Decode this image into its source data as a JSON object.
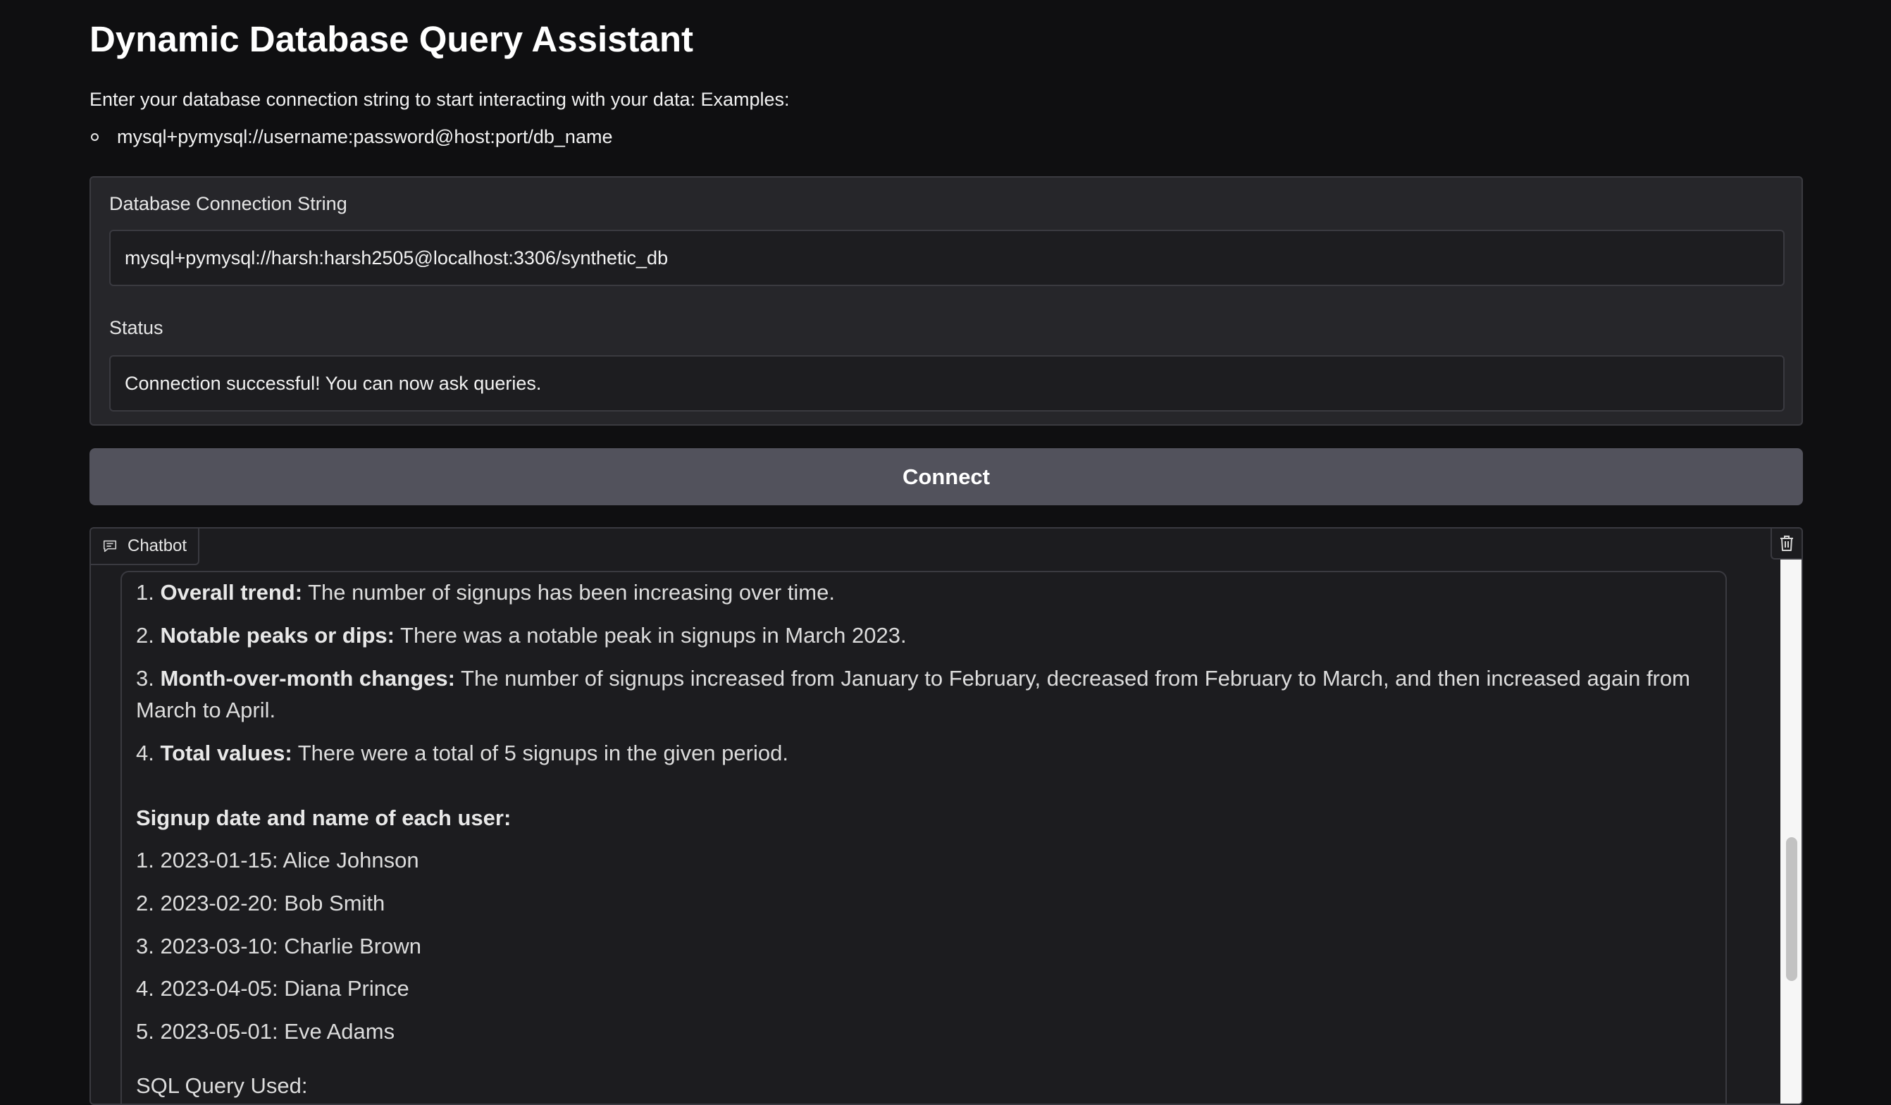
{
  "app": {
    "title": "Dynamic Database Query Assistant",
    "intro": "Enter your database connection string to start interacting with your data: Examples:",
    "examples": [
      "mysql+pymysql://username:password@host:port/db_name"
    ]
  },
  "connection": {
    "label": "Database Connection String",
    "value": "mysql+pymysql://harsh:harsh2505@localhost:3306/synthetic_db",
    "status_label": "Status",
    "status_value": "Connection successful! You can now ask queries.",
    "button_label": "Connect"
  },
  "chatbot": {
    "tab_label": "Chatbot",
    "icons": {
      "tab": "chat-bubble-icon",
      "clear": "trash-icon"
    },
    "analysis": [
      {
        "num": "1.",
        "title": "Overall trend:",
        "text": "The number of signups has been increasing over time."
      },
      {
        "num": "2.",
        "title": "Notable peaks or dips:",
        "text": "There was a notable peak in signups in March 2023."
      },
      {
        "num": "3.",
        "title": "Month-over-month changes:",
        "text": "The number of signups increased from January to February, decreased from February to March, and then increased again from March to April."
      },
      {
        "num": "4.",
        "title": "Total values:",
        "text": "There were a total of 5 signups in the given period."
      }
    ],
    "users_heading": "Signup date and name of each user:",
    "users": [
      "1. 2023-01-15: Alice Johnson",
      "2. 2023-02-20: Bob Smith",
      "3. 2023-03-10: Charlie Brown",
      "4. 2023-04-05: Diana Prince",
      "5. 2023-05-01: Eve Adams"
    ],
    "sql_heading": "SQL Query Used:"
  }
}
